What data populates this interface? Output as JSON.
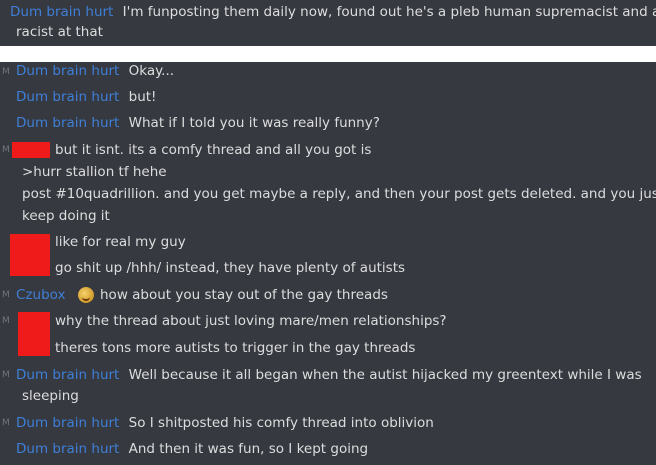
{
  "top_message": {
    "author": "Dum brain hurt",
    "text_line1": "I'm funposting them daily now, found out he's a pleb human supremacist and a",
    "text_line2": "racist at that"
  },
  "gutter_mark": "M",
  "messages": [
    {
      "author": "Dum brain hurt",
      "text": "Okay..."
    },
    {
      "author": "Dum brain hurt",
      "text": "but!"
    },
    {
      "author": "Dum brain hurt",
      "text": "What if I told you it was really funny?"
    },
    {
      "text": "but it isnt. its a comfy thread and all you got is"
    },
    {
      "text": ">hurr stallion tf hehe"
    },
    {
      "text": "post #10quadrillion. and you get maybe a reply, and then your post gets deleted. and you just"
    },
    {
      "text": "keep doing it"
    },
    {
      "text": "like for real my guy"
    },
    {
      "text": "go shit up /hhh/ instead, they have plenty of autists"
    },
    {
      "author": "Czubox",
      "text": "how about you stay out of the gay threads"
    },
    {
      "text": "why the thread about just loving mare/men relationships?"
    },
    {
      "text": "theres tons more autists to trigger in the gay threads"
    },
    {
      "author": "Dum brain hurt",
      "text": "Well because it all began when the autist hijacked my greentext while I was"
    },
    {
      "text": "sleeping"
    },
    {
      "author": "Dum brain hurt",
      "text": "So I shitposted his comfy thread into oblivion"
    },
    {
      "author": "Dum brain hurt",
      "text": "And then it was fun, so I kept going"
    }
  ],
  "icons": {
    "czubox_avatar": "cat-face-emoji",
    "redaction": "red-redaction-box"
  },
  "colors": {
    "background": "#36393f",
    "username": "#3f7fd7",
    "text": "#dcddde",
    "redaction": "#ef1a1a",
    "divider": "#ffffff"
  }
}
